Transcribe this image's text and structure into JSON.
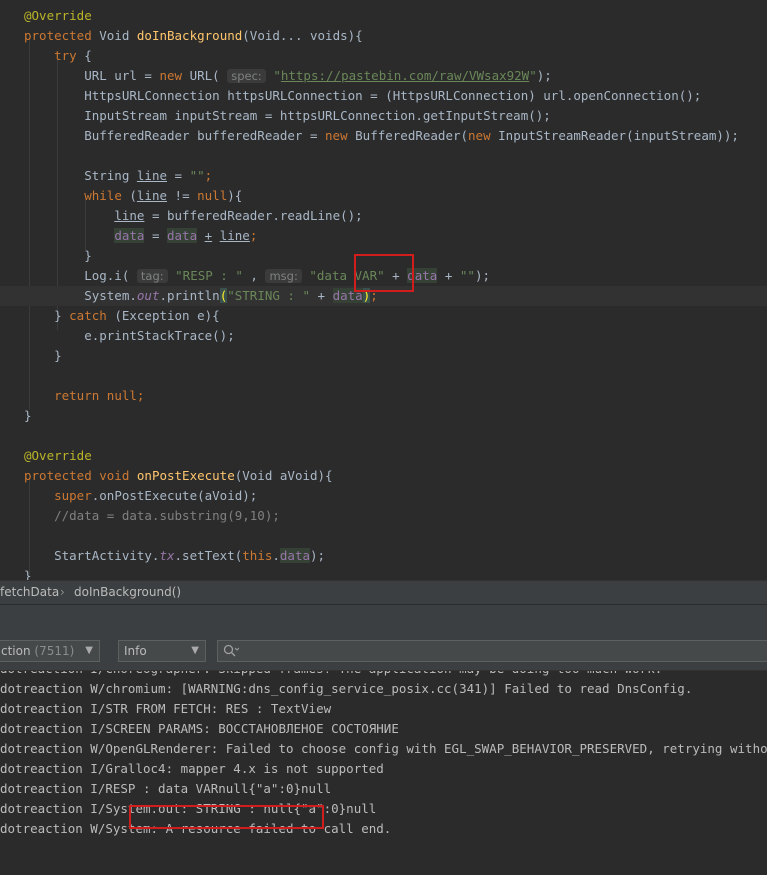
{
  "editor": {
    "lines": [
      [
        {
          "t": "@Override",
          "c": "ann"
        }
      ],
      [
        {
          "t": "protected ",
          "c": "kw"
        },
        {
          "t": "Void "
        },
        {
          "t": "doInBackground",
          "c": "fn"
        },
        {
          "t": "(Void... voids){"
        }
      ],
      [
        {
          "t": "    "
        },
        {
          "t": "try ",
          "c": "kw"
        },
        {
          "t": "{"
        }
      ],
      [
        {
          "t": "        URL url = "
        },
        {
          "t": "new ",
          "c": "kw"
        },
        {
          "t": "URL( "
        },
        {
          "t": "spec:",
          "c": "hint"
        },
        {
          "t": " "
        },
        {
          "t": "\"",
          "c": "str"
        },
        {
          "t": "https://pastebin.com/raw/VWsax92W",
          "c": "url"
        },
        {
          "t": "\"",
          "c": "str"
        },
        {
          "t": ");"
        }
      ],
      [
        {
          "t": "        HttpsURLConnection httpsURLConnection = (HttpsURLConnection) url.openConnection();"
        }
      ],
      [
        {
          "t": "        InputStream inputStream = httpsURLConnection.getInputStream();"
        }
      ],
      [
        {
          "t": "        BufferedReader bufferedReader = "
        },
        {
          "t": "new ",
          "c": "kw"
        },
        {
          "t": "BufferedReader("
        },
        {
          "t": "new ",
          "c": "kw"
        },
        {
          "t": "InputStreamReader(inputStream));"
        }
      ],
      [],
      [
        {
          "t": "        String "
        },
        {
          "t": "line",
          "c": "ul"
        },
        {
          "t": " = "
        },
        {
          "t": "\"\"",
          "c": "str"
        },
        {
          "t": ";",
          "c": "kw"
        }
      ],
      [
        {
          "t": "        "
        },
        {
          "t": "while ",
          "c": "kw"
        },
        {
          "t": "("
        },
        {
          "t": "line",
          "c": "ul"
        },
        {
          "t": " != "
        },
        {
          "t": "null",
          "c": "kw"
        },
        {
          "t": "){"
        }
      ],
      [
        {
          "t": "            "
        },
        {
          "t": "line",
          "c": "ul"
        },
        {
          "t": " = bufferedReader.readLine();"
        }
      ],
      [
        {
          "t": "            "
        },
        {
          "t": "data",
          "c": "fld hl"
        },
        {
          "t": " = "
        },
        {
          "t": "data",
          "c": "fld hl"
        },
        {
          "t": " "
        },
        {
          "t": "+",
          "c": "ul"
        },
        {
          "t": " "
        },
        {
          "t": "line",
          "c": "ul"
        },
        {
          "t": ";",
          "c": "kw"
        }
      ],
      [
        {
          "t": "        }"
        }
      ],
      [
        {
          "t": "        Log.i( "
        },
        {
          "t": "tag:",
          "c": "hint"
        },
        {
          "t": " "
        },
        {
          "t": "\"RESP : \"",
          "c": "str"
        },
        {
          "t": " , "
        },
        {
          "t": "msg:",
          "c": "hint"
        },
        {
          "t": " "
        },
        {
          "t": "\"data VAR\"",
          "c": "str"
        },
        {
          "t": " + "
        },
        {
          "t": "data",
          "c": "fld hl"
        },
        {
          "t": " + "
        },
        {
          "t": "\"\"",
          "c": "str"
        },
        {
          "t": ");"
        }
      ],
      [
        {
          "t": "        System."
        },
        {
          "t": "out",
          "c": "stat"
        },
        {
          "t": ".println"
        },
        {
          "t": "(",
          "c": "brace"
        },
        {
          "t": "\"STRING : \"",
          "c": "str"
        },
        {
          "t": " + "
        },
        {
          "t": "data",
          "c": "fld hl"
        },
        {
          "t": ")",
          "c": "brace"
        },
        {
          "t": ";",
          "c": "kw"
        }
      ],
      [
        {
          "t": "    } "
        },
        {
          "t": "catch ",
          "c": "kw"
        },
        {
          "t": "(Exception e){"
        }
      ],
      [
        {
          "t": "        e.printStackTrace();"
        }
      ],
      [
        {
          "t": "    }"
        }
      ],
      [],
      [
        {
          "t": "    "
        },
        {
          "t": "return null",
          "c": "kw"
        },
        {
          "t": ";",
          "c": "kw"
        }
      ],
      [
        {
          "t": "}"
        }
      ],
      [],
      [
        {
          "t": "@Override",
          "c": "ann"
        }
      ],
      [
        {
          "t": "protected void ",
          "c": "kw"
        },
        {
          "t": "onPostExecute",
          "c": "fn"
        },
        {
          "t": "(Void aVoid){"
        }
      ],
      [
        {
          "t": "    "
        },
        {
          "t": "super",
          "c": "kw"
        },
        {
          "t": ".onPostExecute(aVoid);"
        }
      ],
      [
        {
          "t": "    //data = data.substring(9,10);",
          "c": "cmt"
        }
      ],
      [],
      [
        {
          "t": "    StartActivity."
        },
        {
          "t": "tx",
          "c": "stat"
        },
        {
          "t": ".setText("
        },
        {
          "t": "this",
          "c": "kw"
        },
        {
          "t": "."
        },
        {
          "t": "data",
          "c": "fld hl"
        },
        {
          "t": ");"
        }
      ],
      [
        {
          "t": "}"
        }
      ]
    ]
  },
  "breadcrumb": {
    "class_name": "fetchData",
    "separator": "›",
    "method_name": "doInBackground()"
  },
  "logcat": {
    "process_select": {
      "label": "ction",
      "pid": "(7511)"
    },
    "level_select": {
      "value": "Info"
    },
    "search": {
      "value": ""
    },
    "lines": [
      "dotreaction I/Choreographer: Skipped frames! The application may be doing too much work.",
      "dotreaction W/chromium: [WARNING:dns_config_service_posix.cc(341)] Failed to read DnsConfig.",
      "dotreaction I/STR FROM FETCH: RES : TextView",
      "dotreaction I/SCREEN PARAMS: ВОССТАНОВЛЕНОЕ СОСТОЯНИЕ",
      "dotreaction W/OpenGLRenderer: Failed to choose config with EGL_SWAP_BEHAVIOR_PRESERVED, retrying without...",
      "dotreaction I/Gralloc4: mapper 4.x is not supported",
      "dotreaction I/RESP : data VARnull{\"a\":0}null",
      "dotreaction I/System.out: STRING : null{\"a\":0}null",
      "dotreaction W/System: A resource failed to call end."
    ]
  },
  "colors": {
    "highlight_box": "#d21d1d",
    "editor_bg": "#2b2b2b",
    "panel_bg": "#3c3f41"
  }
}
